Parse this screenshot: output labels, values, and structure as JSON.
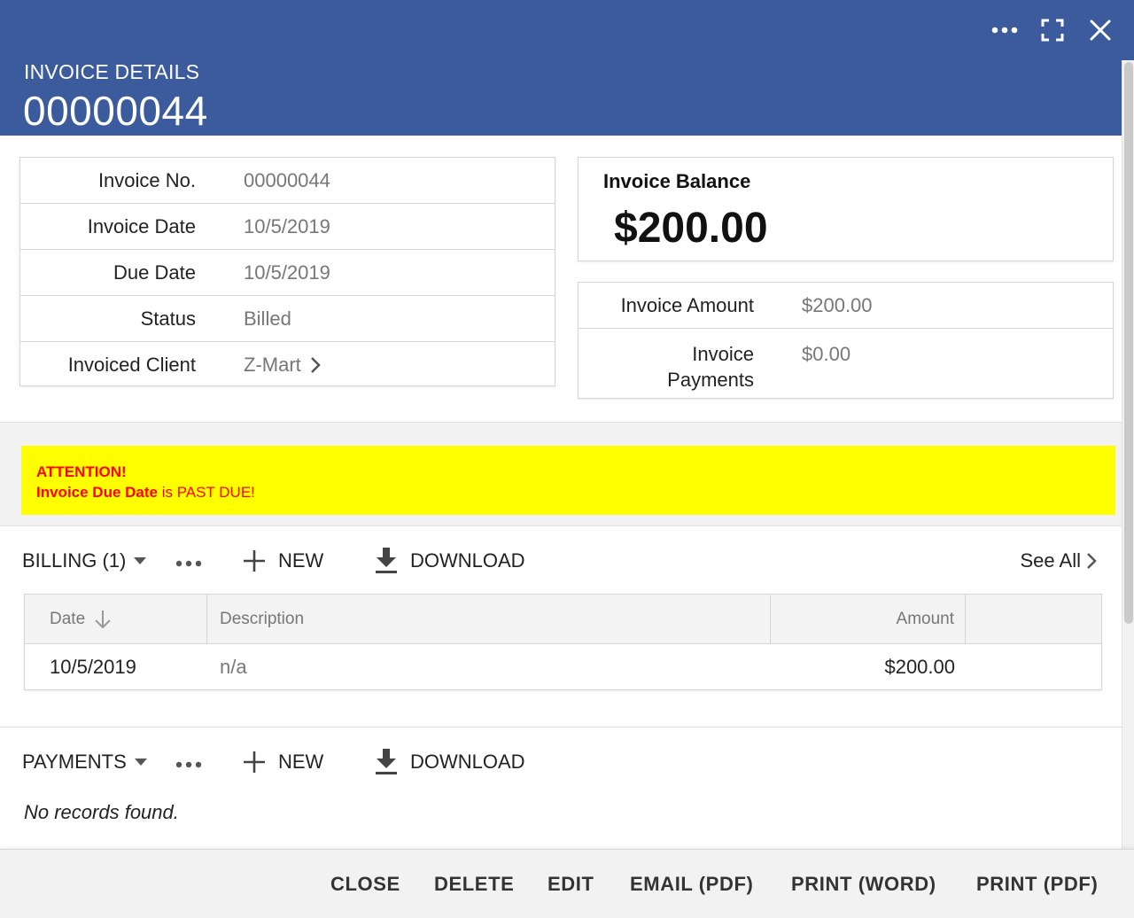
{
  "header": {
    "subtitle": "INVOICE DETAILS",
    "title": "00000044",
    "background_color": "#3c5b9c",
    "actions": [
      "more-icon",
      "fullscreen-icon",
      "close-icon"
    ]
  },
  "details": {
    "rows": [
      {
        "label": "Invoice No.",
        "value": "00000044"
      },
      {
        "label": "Invoice Date",
        "value": "10/5/2019"
      },
      {
        "label": "Due Date",
        "value": "10/5/2019"
      },
      {
        "label": "Status",
        "value": "Billed"
      },
      {
        "label": "Invoiced Client",
        "value": "Z-Mart"
      }
    ]
  },
  "balance": {
    "label": "Invoice Balance",
    "value": "$200.00"
  },
  "amounts": {
    "invoice_amount_label": "Invoice Amount",
    "invoice_amount_value": "$200.00",
    "payments_label_line1": "Invoice",
    "payments_label_line2": "Payments",
    "payments_value": "$0.00"
  },
  "alert": {
    "heading": "ATTENTION!",
    "bold_text": "Invoice Due Date",
    "rest_text": " is PAST DUE!",
    "background_color": "#ffff00",
    "text_color": "#ff0000"
  },
  "billing": {
    "title": "BILLING (1)",
    "new_label": "NEW",
    "download_label": "DOWNLOAD",
    "see_all_label": "See All",
    "columns": {
      "date": "Date",
      "description": "Description",
      "amount": "Amount"
    },
    "rows": [
      {
        "date": "10/5/2019",
        "description": "n/a",
        "amount": "$200.00"
      }
    ]
  },
  "payments": {
    "title": "PAYMENTS",
    "new_label": "NEW",
    "download_label": "DOWNLOAD",
    "empty_text": "No records found."
  },
  "footer": {
    "close": "CLOSE",
    "delete": "DELETE",
    "edit": "EDIT",
    "email_pdf": "EMAIL (PDF)",
    "print_word": "PRINT (WORD)",
    "print_pdf": "PRINT (PDF)"
  }
}
